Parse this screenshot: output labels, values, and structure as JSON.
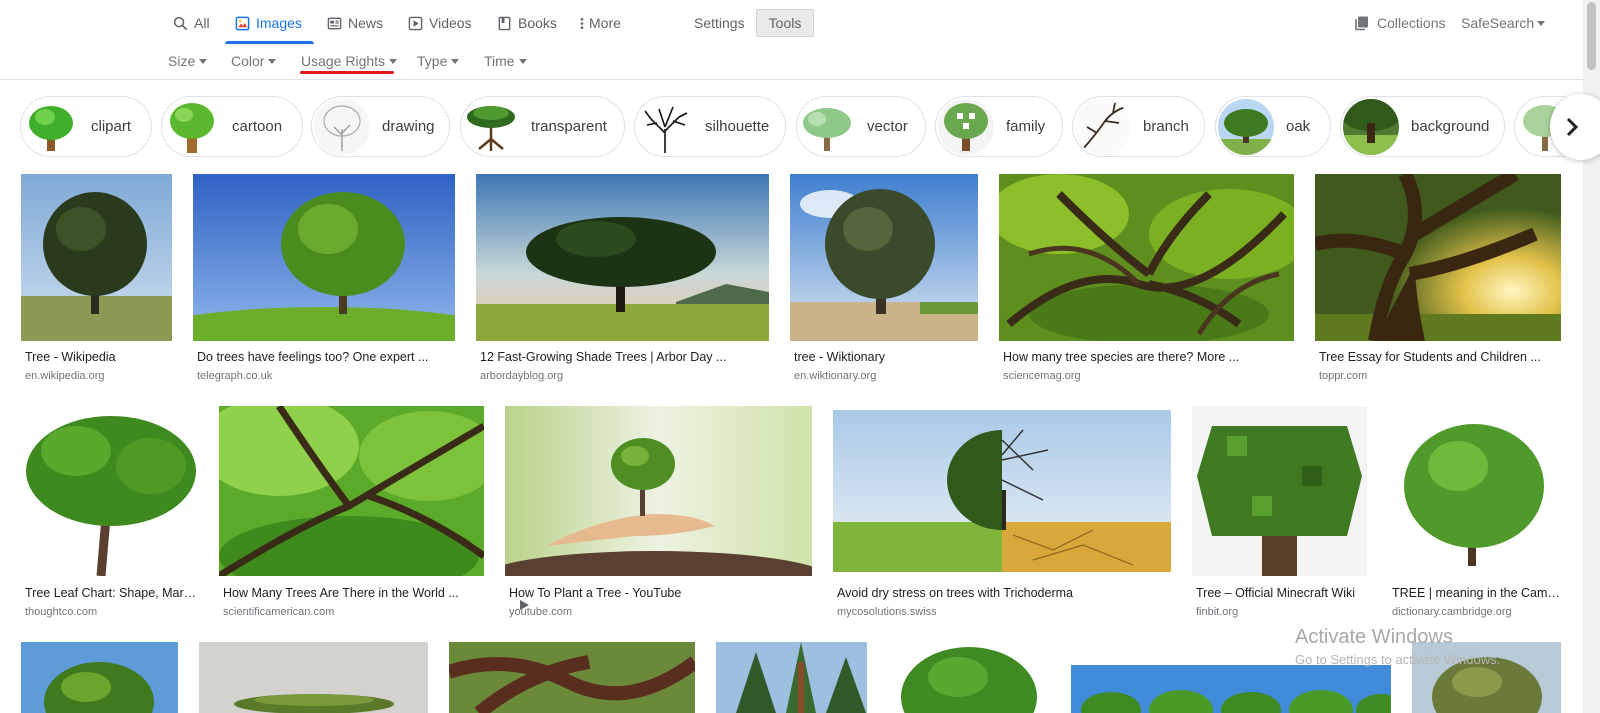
{
  "nav": {
    "tabs": [
      {
        "label": "All",
        "icon": "search-icon"
      },
      {
        "label": "Images",
        "icon": "image-icon",
        "active": true
      },
      {
        "label": "News",
        "icon": "news-icon"
      },
      {
        "label": "Videos",
        "icon": "play-icon"
      },
      {
        "label": "Books",
        "icon": "book-icon"
      },
      {
        "label": "More",
        "icon": "more-vert-icon"
      }
    ],
    "settings": "Settings",
    "tools": "Tools",
    "collections": "Collections",
    "safesearch": "SafeSearch"
  },
  "filters": [
    "Size",
    "Color",
    "Usage Rights",
    "Type",
    "Time"
  ],
  "chips": [
    "clipart",
    "cartoon",
    "drawing",
    "transparent",
    "silhouette",
    "vector",
    "family",
    "branch",
    "oak",
    "background"
  ],
  "results": [
    {
      "title": "Tree - Wikipedia",
      "source": "en.wikipedia.org"
    },
    {
      "title": "Do trees have feelings too? One expert ...",
      "source": "telegraph.co.uk"
    },
    {
      "title": "12 Fast-Growing Shade Trees | Arbor Day ...",
      "source": "arbordayblog.org"
    },
    {
      "title": "tree - Wiktionary",
      "source": "en.wiktionary.org"
    },
    {
      "title": "How many tree species are there? More ...",
      "source": "sciencemag.org"
    },
    {
      "title": "Tree Essay for Students and Children ...",
      "source": "toppr.com"
    },
    {
      "title": "Tree Leaf Chart: Shape, Margin ...",
      "source": "thoughtco.com"
    },
    {
      "title": "How Many Trees Are There in the World ...",
      "source": "scientificamerican.com"
    },
    {
      "title": "How To Plant a Tree - YouTube",
      "source": "youtube.com"
    },
    {
      "title": "Avoid dry stress on trees with Trichoderma",
      "source": "mycosolutions.swiss"
    },
    {
      "title": "Tree – Official Minecraft Wiki",
      "source": "finbit.org"
    },
    {
      "title": "TREE | meaning in the Cambridge ...",
      "source": "dictionary.cambridge.org"
    }
  ],
  "watermark": {
    "title": "Activate Windows",
    "subtitle": "Go to Settings to activate Windows."
  },
  "colors": {
    "accent": "#1a73e8",
    "highlight": "#e01b1b",
    "text": "#202124",
    "muted": "#70757a"
  }
}
